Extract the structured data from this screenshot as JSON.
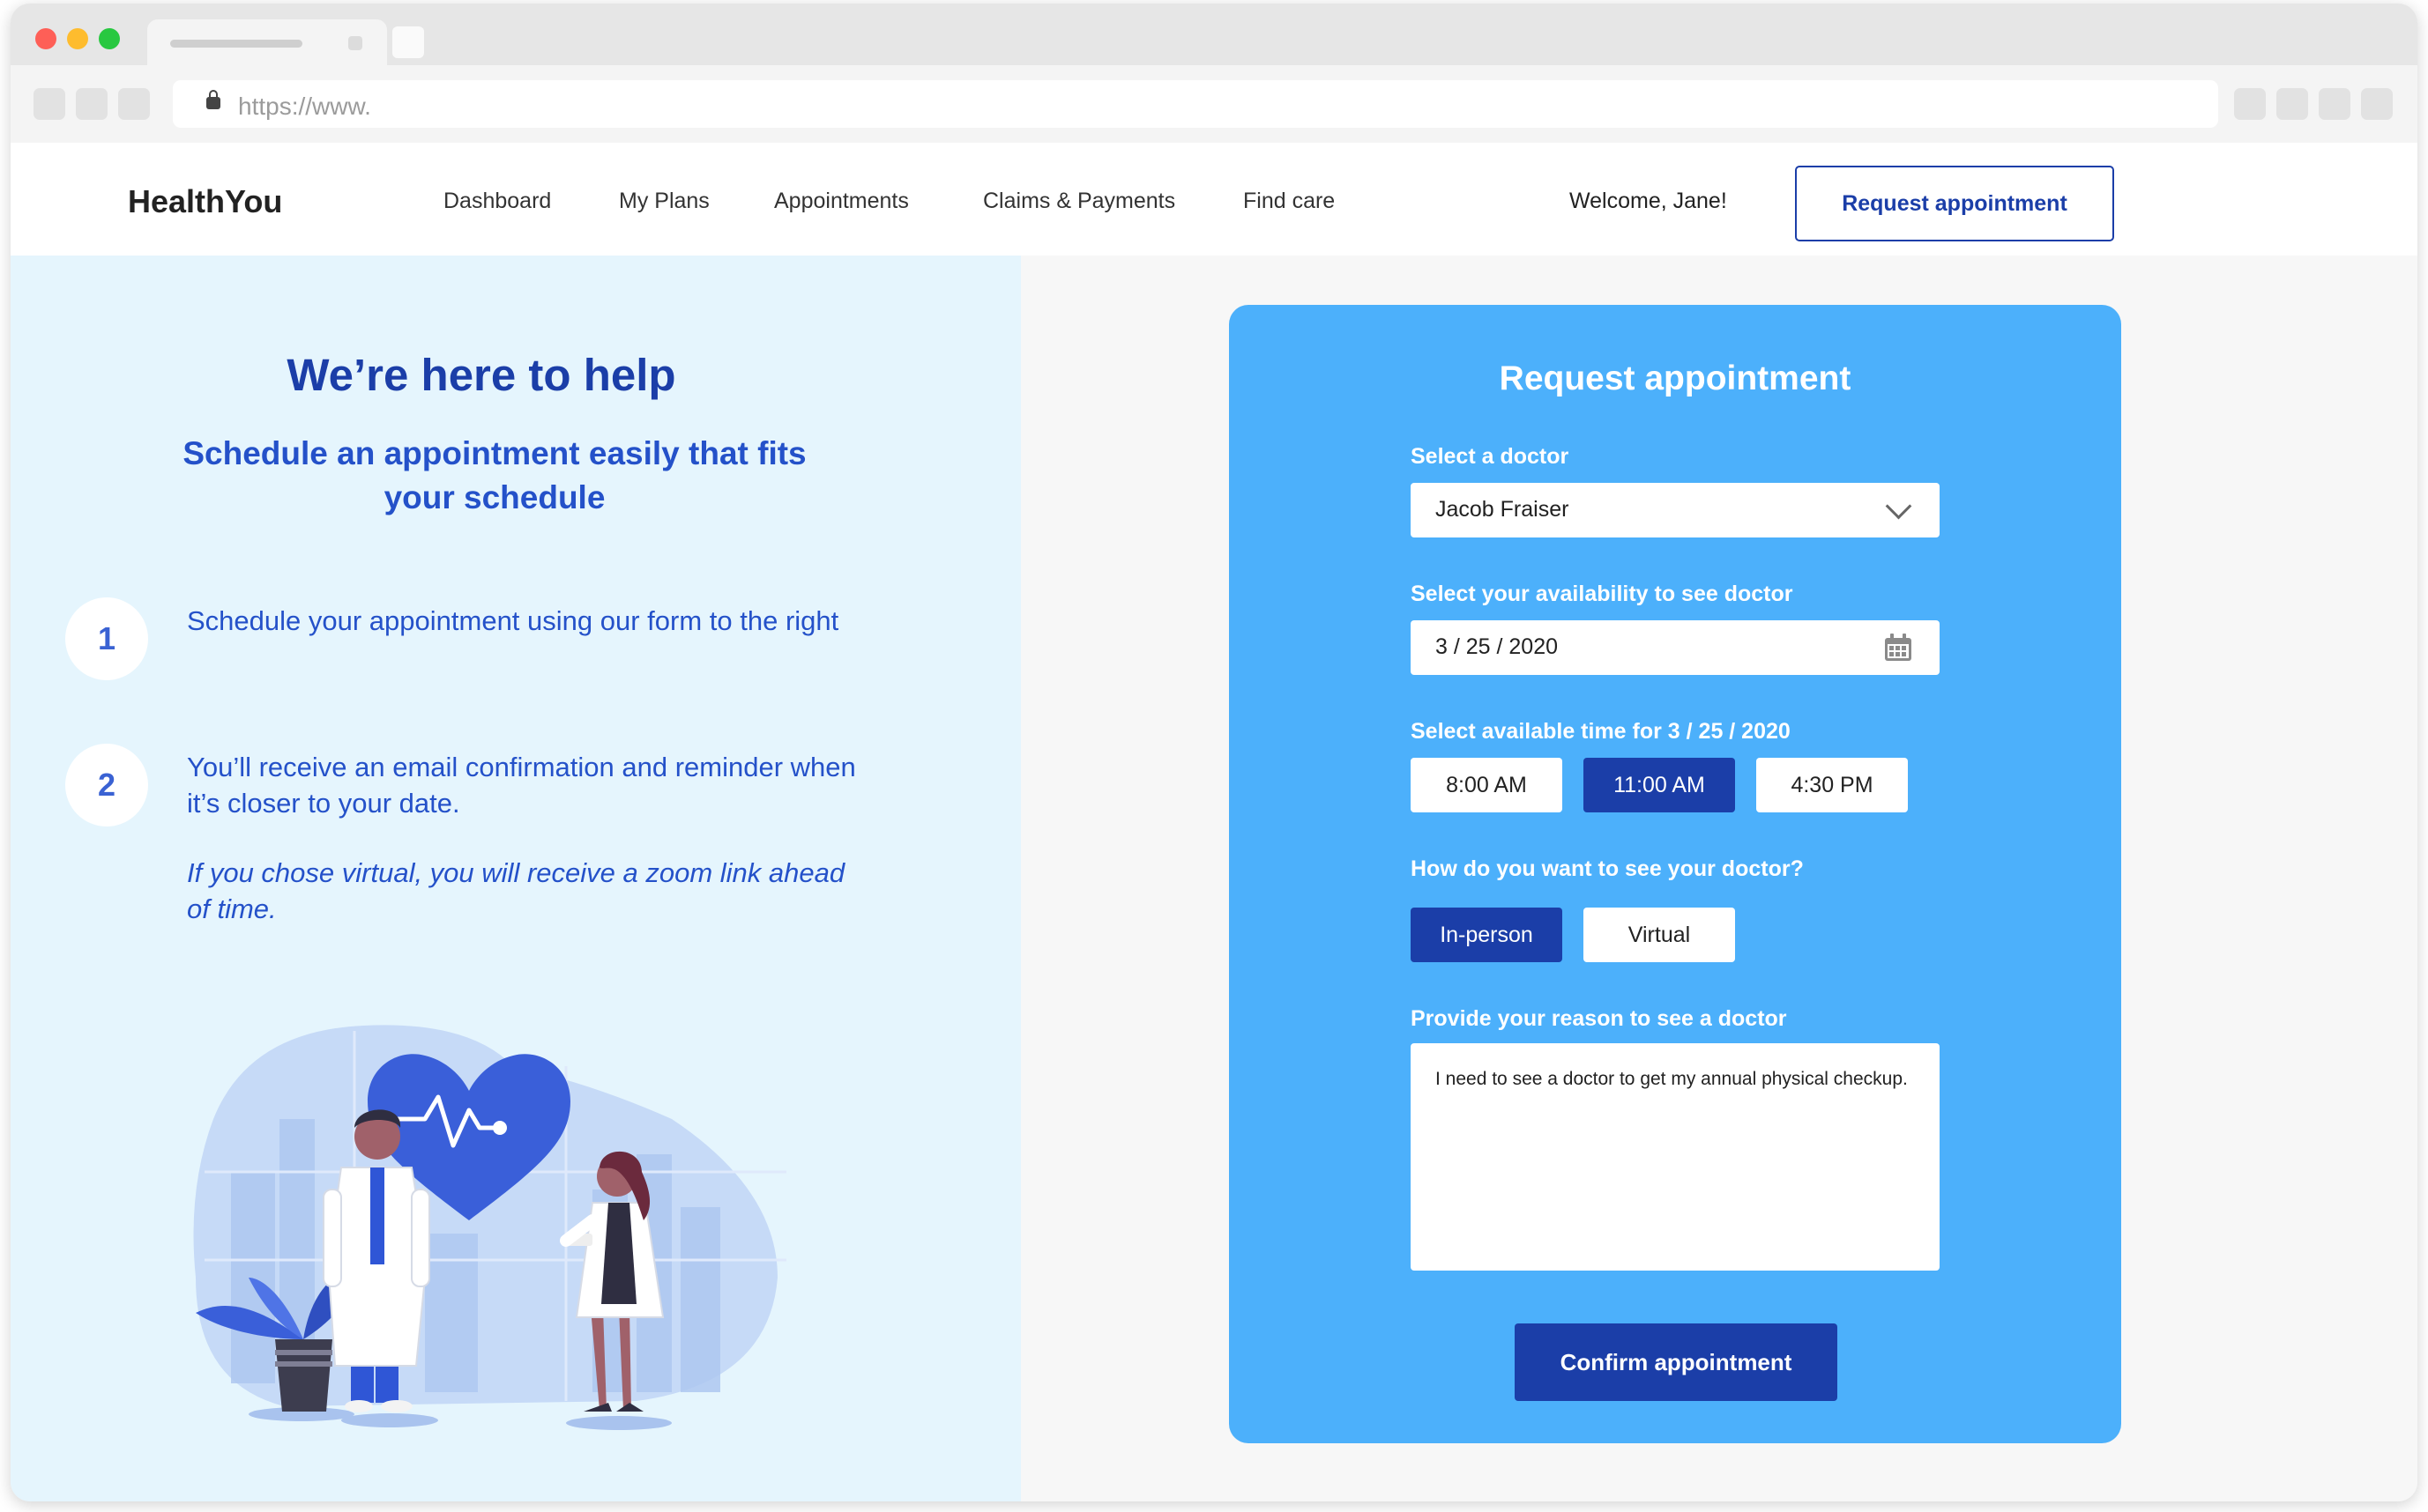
{
  "browser": {
    "url": "https://www."
  },
  "header": {
    "brand": "HealthYou",
    "nav": [
      "Dashboard",
      "My Plans",
      "Appointments",
      "Claims & Payments",
      "Find care"
    ],
    "welcome": "Welcome, Jane!",
    "request_button": "Request appointment"
  },
  "left": {
    "title": "We’re here to help",
    "subtitle": "Schedule an appointment easily that fits your schedule",
    "steps": [
      {
        "number": "1",
        "text": "Schedule your appointment using our form to the right"
      },
      {
        "number": "2",
        "text": "You’ll receive an email confirmation and reminder when it’s closer to your date."
      }
    ],
    "note": "If you chose virtual, you will receive a zoom link ahead of time."
  },
  "form": {
    "title": "Request appointment",
    "doctor_label": "Select a doctor",
    "doctor_value": "Jacob Fraiser",
    "date_label": "Select your availability to see doctor",
    "date_value": "3 / 25 / 2020",
    "time_label": "Select available time for 3 / 25 / 2020",
    "times": [
      "8:00 AM",
      "11:00 AM",
      "4:30 PM"
    ],
    "selected_time": "11:00 AM",
    "mode_label": "How do you want to see your doctor?",
    "modes": [
      "In-person",
      "Virtual"
    ],
    "selected_mode": "In-person",
    "reason_label": "Provide your reason to see a doctor",
    "reason_value": "I need to see a doctor to get my annual physical checkup.",
    "confirm_button": "Confirm appointment"
  },
  "icons": {
    "dropdown": "chevron-down-icon",
    "date": "calendar-icon",
    "secure": "lock-icon"
  },
  "colors": {
    "primary": "#1b3ea8",
    "card": "#4cb0fb",
    "left_panel_bg": "#e5f5fd",
    "accent_text": "#2451c9"
  }
}
